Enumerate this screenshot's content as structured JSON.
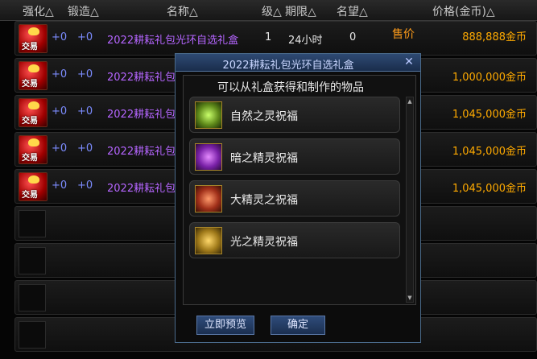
{
  "header": {
    "enhance": "强化△",
    "forge": "锻造△",
    "name": "名称△",
    "level": "级△",
    "duration": "期限△",
    "reputation": "名望△",
    "price": "价格(金币)△"
  },
  "icons": {
    "item": "gift-box-icon"
  },
  "items": [
    {
      "tag": "交易",
      "enhance": "+0",
      "forge": "+0",
      "name": "2022耕耘礼包光环自选礼盒",
      "level": "1",
      "duration": "24小时",
      "reputation": "0",
      "status": "售价",
      "price": "888,888金币"
    },
    {
      "tag": "交易",
      "enhance": "+0",
      "forge": "+0",
      "name": "2022耕耘礼包",
      "price": "1,000,000金币"
    },
    {
      "tag": "交易",
      "enhance": "+0",
      "forge": "+0",
      "name": "2022耕耘礼包",
      "price": "1,045,000金币"
    },
    {
      "tag": "交易",
      "enhance": "+0",
      "forge": "+0",
      "name": "2022耕耘礼包",
      "price": "1,045,000金币"
    },
    {
      "tag": "交易",
      "enhance": "+0",
      "forge": "+0",
      "name": "2022耕耘礼包",
      "price": "1,045,000金币"
    }
  ],
  "dialog": {
    "title": "2022耕耘礼包光环自选礼盒",
    "close": "✕",
    "subtitle": "可以从礼盒获得和制作的物品",
    "options": [
      {
        "label": "自然之灵祝福",
        "icon": "nature-spirit-blessing-icon"
      },
      {
        "label": "暗之精灵祝福",
        "icon": "dark-spirit-blessing-icon"
      },
      {
        "label": "大精灵之祝福",
        "icon": "great-spirit-blessing-icon"
      },
      {
        "label": "光之精灵祝福",
        "icon": "light-spirit-blessing-icon"
      }
    ],
    "preview_button": "立即预览",
    "confirm_button": "确定"
  }
}
